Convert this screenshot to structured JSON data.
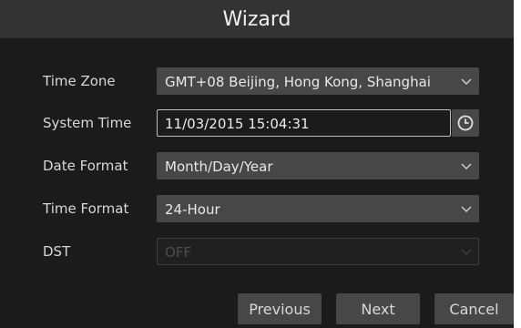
{
  "title": "Wizard",
  "fields": {
    "time_zone": {
      "label": "Time Zone",
      "value": "GMT+08 Beijing, Hong Kong, Shanghai"
    },
    "system_time": {
      "label": "System Time",
      "value": "11/03/2015 15:04:31"
    },
    "date_format": {
      "label": "Date Format",
      "value": "Month/Day/Year"
    },
    "time_format": {
      "label": "Time Format",
      "value": "24-Hour"
    },
    "dst": {
      "label": "DST",
      "value": "OFF"
    }
  },
  "buttons": {
    "previous": "Previous",
    "next": "Next",
    "cancel": "Cancel"
  },
  "icons": {
    "clock": "clock-icon",
    "dropdown": "chevron-down-icon"
  },
  "colors": {
    "dialog_bg": "#1b1b1b",
    "titlebar_bg": "#333333",
    "control_bg": "#474747",
    "disabled_text": "#4e4e4e"
  }
}
